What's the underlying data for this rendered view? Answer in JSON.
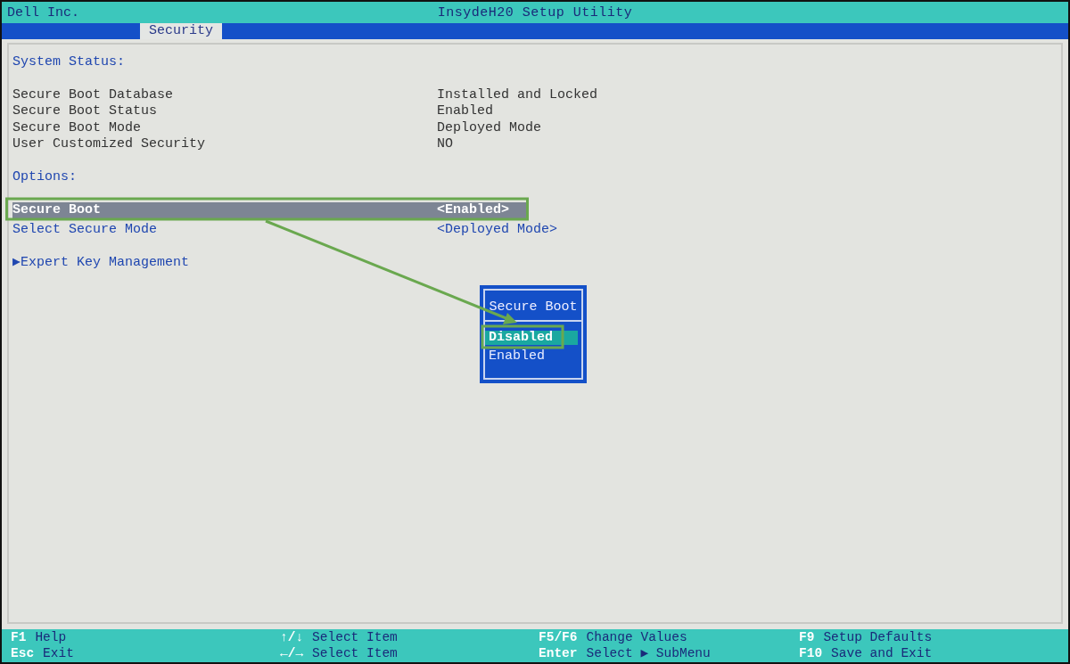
{
  "header": {
    "vendor": "Dell Inc.",
    "title": "InsydeH20 Setup Utility"
  },
  "tabs": [
    {
      "label": "Security",
      "selected": true
    }
  ],
  "sections": [
    {
      "heading": "System Status:",
      "rows": [
        {
          "kind": "info",
          "label": "Secure Boot Database",
          "value": "Installed and Locked"
        },
        {
          "kind": "info",
          "label": "Secure Boot Status",
          "value": "Enabled"
        },
        {
          "kind": "info",
          "label": "Secure Boot Mode",
          "value": "Deployed Mode"
        },
        {
          "kind": "info",
          "label": "User Customized Security",
          "value": "NO"
        }
      ]
    },
    {
      "heading": "Options:",
      "rows": [
        {
          "kind": "option",
          "label": "Secure Boot",
          "value": "<Enabled>",
          "selected": true
        },
        {
          "kind": "option",
          "label": "Select Secure Mode",
          "value": "<Deployed Mode>",
          "selected": false
        },
        {
          "kind": "submenu",
          "marker": "▶",
          "label": "Expert Key Management",
          "selected": false
        }
      ]
    }
  ],
  "popup": {
    "title": "Secure Boot",
    "options": [
      {
        "label": "Disabled",
        "selected": true
      },
      {
        "label": "Enabled",
        "selected": false
      }
    ]
  },
  "footer": [
    {
      "key": "F1",
      "action": "Help"
    },
    {
      "key": "↑/↓",
      "action": "Select Item"
    },
    {
      "key": "F5/F6",
      "action": "Change Values"
    },
    {
      "key": "F9",
      "action": "Setup Defaults"
    },
    {
      "key": "Esc",
      "action": "Exit"
    },
    {
      "key": "←/→",
      "action": "Select Item"
    },
    {
      "key": "Enter",
      "action": "Select ▶ SubMenu"
    },
    {
      "key": "F10",
      "action": "Save and Exit"
    }
  ]
}
